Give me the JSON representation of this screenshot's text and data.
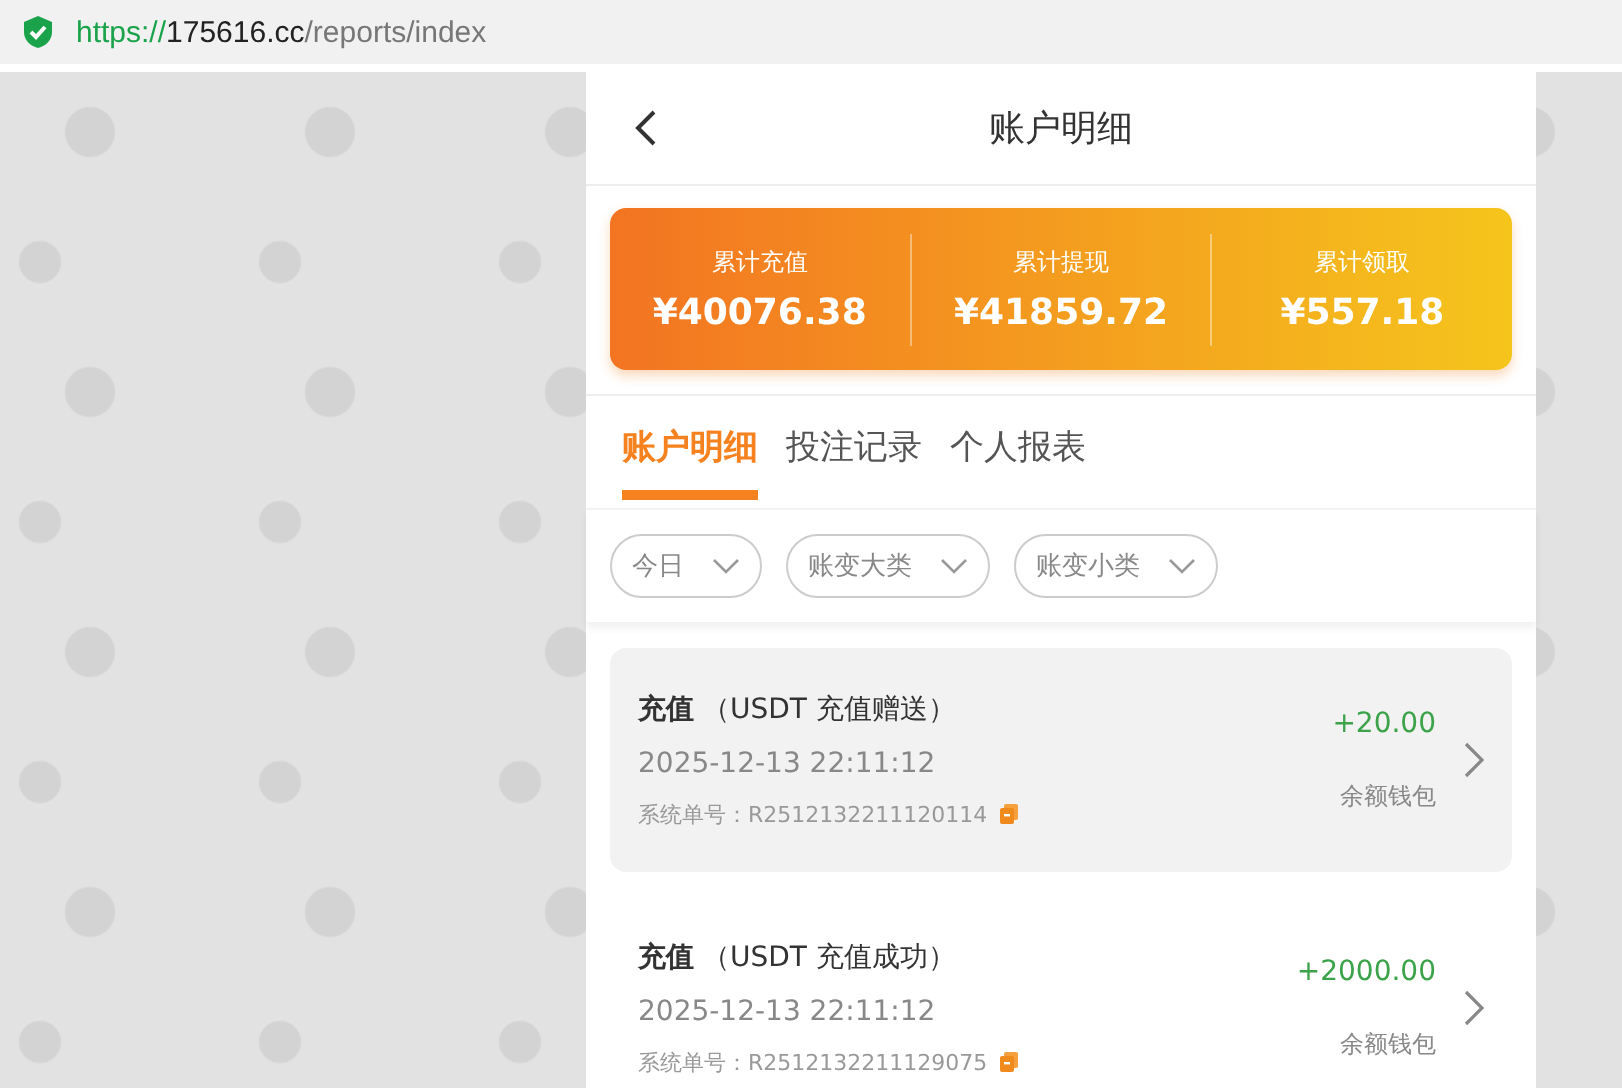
{
  "address_bar": {
    "scheme": "https://",
    "host": "175616.cc",
    "path": "/reports/index"
  },
  "header": {
    "title": "账户明细"
  },
  "summary": [
    {
      "label": "累计充值",
      "value": "¥40076.38"
    },
    {
      "label": "累计提现",
      "value": "¥41859.72"
    },
    {
      "label": "累计领取",
      "value": "¥557.18"
    }
  ],
  "tabs": [
    {
      "label": "账户明细",
      "selected": true
    },
    {
      "label": "投注记录",
      "selected": false
    },
    {
      "label": "个人报表",
      "selected": false
    }
  ],
  "filters": [
    {
      "label": "今日"
    },
    {
      "label": "账变大类"
    },
    {
      "label": "账变小类"
    }
  ],
  "records": [
    {
      "type": "充值",
      "detail": "（USDT 充值赠送）",
      "time": "2025-12-13 22:11:12",
      "order": "系统单号：R2512132211120114",
      "amount": "+20.00",
      "wallet": "余额钱包",
      "selected": true
    },
    {
      "type": "充值",
      "detail": "（USDT 充值成功）",
      "time": "2025-12-13 22:11:12",
      "order": "系统单号：R2512132211129075",
      "amount": "+2000.00",
      "wallet": "余额钱包",
      "selected": false
    }
  ]
}
